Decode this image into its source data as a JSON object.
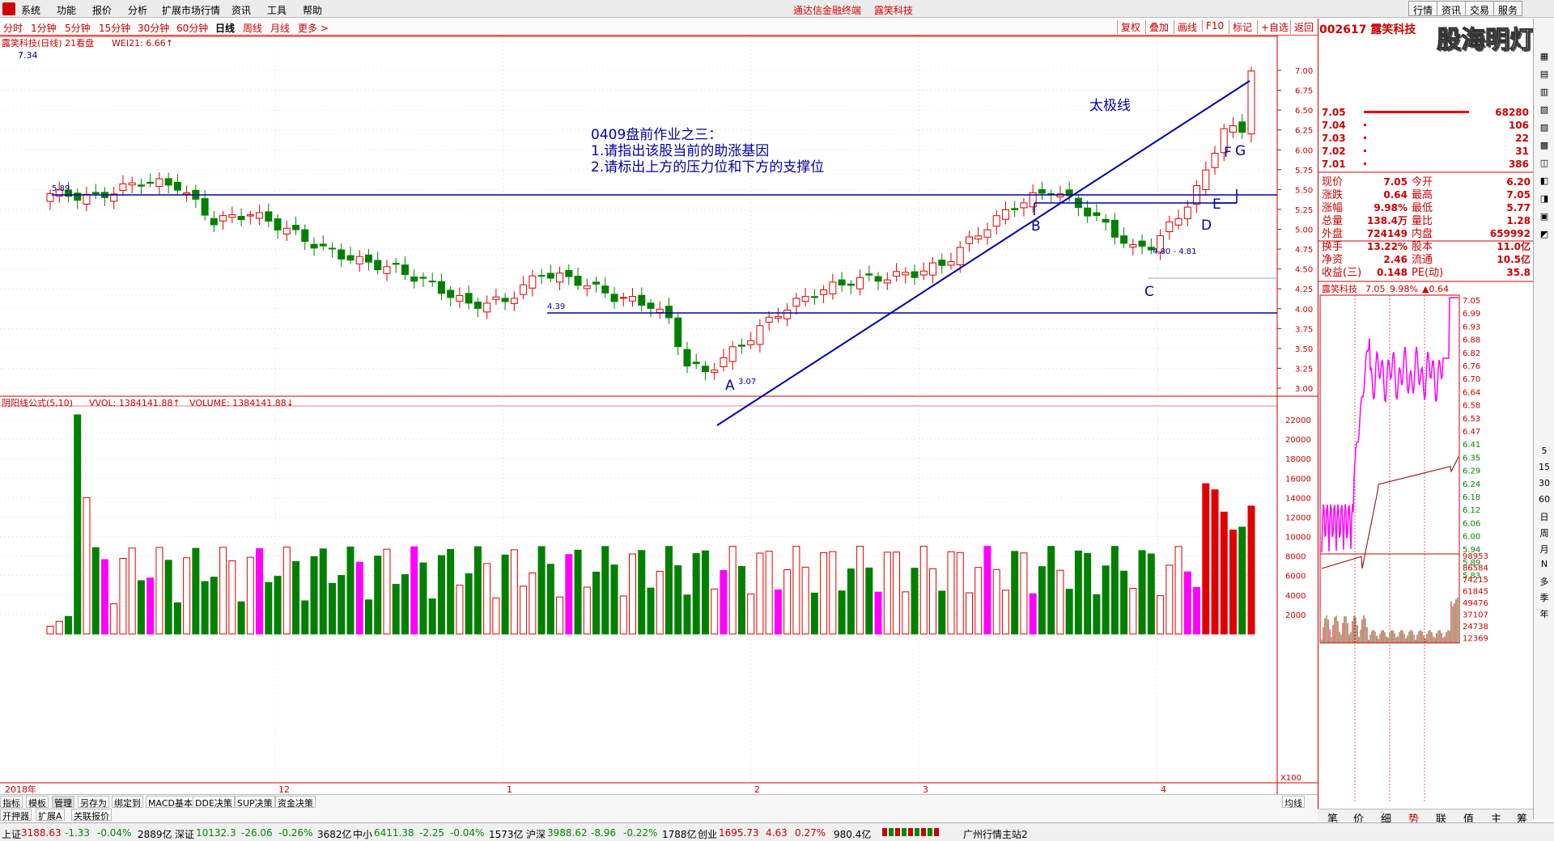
{
  "menu": {
    "items": [
      "系统",
      "功能",
      "报价",
      "分析",
      "扩展市场行情",
      "资讯",
      "工具",
      "帮助"
    ],
    "center_title": "通达信金融终端",
    "stock_short": "露笑科技",
    "right_buttons": [
      "行情",
      "资讯",
      "交易",
      "服务"
    ]
  },
  "toolbar": {
    "periods": [
      "分时",
      "1分钟",
      "5分钟",
      "15分钟",
      "30分钟",
      "60分钟",
      "日线",
      "周线",
      "月线",
      "更多 >"
    ],
    "active": "日线",
    "right": [
      "复权",
      "叠加",
      "画线",
      "F10",
      "标记",
      "+自选",
      "返回"
    ]
  },
  "chart_header": {
    "left": "露笑科技(日线) 21看盘",
    "wei": "WEI21: 6.66↑",
    "top_price": "7.34"
  },
  "annotations": {
    "homework_title": "0409盘前作业之三：",
    "q1": "1.请指出该股当前的助涨基因",
    "q2": "2.请标出上方的压力位和下方的支撑位",
    "taiji": "太极线",
    "A": "A",
    "B": "B",
    "C": "C",
    "D": "D",
    "E": "E",
    "F": "F",
    "G": "G",
    "level_589": "5.89",
    "level_439": "4.39",
    "low_307": "3.07",
    "range": "4.80 - 4.81"
  },
  "price_axis": [
    "7.00",
    "6.75",
    "6.50",
    "6.25",
    "6.00",
    "5.75",
    "5.50",
    "5.25",
    "5.00",
    "4.75",
    "4.50",
    "4.25",
    "4.00",
    "3.75",
    "3.50",
    "3.25",
    "3.00"
  ],
  "vol_header": {
    "title": "阴阳线公式(5,10)",
    "vvol": "VVOL: 1384141.88↑",
    "volume": "VOLUME: 1384141.88↓"
  },
  "vol_axis": [
    "22000",
    "20000",
    "18000",
    "16000",
    "14000",
    "12000",
    "10000",
    "8000",
    "6000",
    "4000",
    "2000"
  ],
  "vol_unit": "X100",
  "date_labels": [
    "2018年",
    "12",
    "1",
    "2",
    "3",
    "4"
  ],
  "quote": {
    "code_name": "002617 露笑科技",
    "asks": [
      {
        "p": "7.05",
        "v": "68280"
      },
      {
        "p": "7.04",
        "v": "106"
      },
      {
        "p": "7.03",
        "v": "22"
      },
      {
        "p": "7.02",
        "v": "31"
      },
      {
        "p": "7.01",
        "v": "386"
      }
    ],
    "rows": [
      [
        "现价",
        "7.05",
        "今开",
        "6.20"
      ],
      [
        "涨跌",
        "0.64",
        "最高",
        "7.05"
      ],
      [
        "涨幅",
        "9.98%",
        "最低",
        "5.77"
      ],
      [
        "总量",
        "138.4万",
        "量比",
        "1.28"
      ],
      [
        "外盘",
        "724149",
        "内盘",
        "659992"
      ],
      [
        "换手",
        "13.22%",
        "股本",
        "11.0亿"
      ],
      [
        "净资",
        "2.46",
        "流通",
        "10.5亿"
      ],
      [
        "收益(三)",
        "0.148",
        "PE(动)",
        "35.8"
      ]
    ],
    "mini_title": "露笑科技",
    "mini_price": "7.05",
    "mini_pct": "9.98%",
    "mini_chg": "▲0.64",
    "mini_axis": [
      "7.05",
      "6.99",
      "6.93",
      "6.88",
      "6.82",
      "6.76",
      "6.70",
      "6.64",
      "6.58",
      "6.53",
      "6.47",
      "6.41",
      "6.35",
      "6.29",
      "6.24",
      "6.18",
      "6.12",
      "6.06",
      "6.00",
      "5.94",
      "5.89",
      "5.83"
    ],
    "mini_vol_axis": [
      "98953",
      "86584",
      "74215",
      "61845",
      "49476",
      "37107",
      "24738",
      "12369"
    ],
    "bottom_tabs": [
      "笔",
      "价",
      "细",
      "势",
      "联",
      "值",
      "主",
      "筹"
    ]
  },
  "side_buttons": [
    "5",
    "15",
    "30",
    "60",
    "日",
    "周",
    "月",
    "N",
    "多",
    "季",
    "年"
  ],
  "bottom_tabs": {
    "row1": [
      "指标",
      "模板",
      "管理",
      "另存为",
      "绑定到",
      "MACD基本",
      "DDE决策",
      "SUP决策",
      "资金决策"
    ],
    "row2": [
      "开押器",
      "扩展A",
      "关联报价"
    ],
    "right": "均线"
  },
  "status": [
    "上证",
    "3188.63",
    "-1.33",
    "-0.04%",
    "2889亿",
    "深证",
    "10132.3",
    "-26.06",
    "-0.26%",
    "3682亿",
    "中小",
    "6411.38",
    "-2.25",
    "-0.04%",
    "1573亿",
    "沪深",
    "3988.62",
    "-8.96",
    "-0.22%",
    "1788亿",
    "创业",
    "1695.73",
    "4.63",
    "0.27%",
    "980.4亿",
    "广州行情主站2"
  ],
  "colors": {
    "up": "#e00000",
    "down": "#008000",
    "line": "#0000a0",
    "vol_purple": "#ff00ff"
  }
}
